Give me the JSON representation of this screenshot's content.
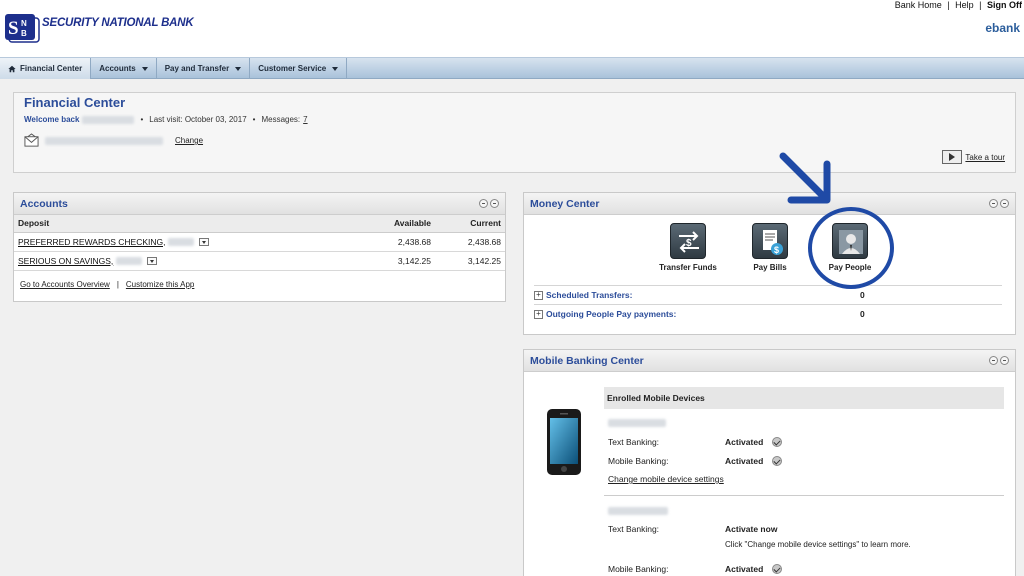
{
  "header": {
    "bank_name": "SECURITY NATIONAL BANK",
    "logo_letters": "SNB",
    "brand_right": "ebank",
    "links": {
      "home": "Bank Home",
      "sep": "|",
      "help": "Help",
      "sign_off": "Sign Off"
    }
  },
  "nav": {
    "items": [
      {
        "label": "Financial Center"
      },
      {
        "label": "Accounts"
      },
      {
        "label": "Pay and Transfer"
      },
      {
        "label": "Customer Service"
      }
    ]
  },
  "financial_center": {
    "title": "Financial Center",
    "welcome": "Welcome back",
    "bullet": "•",
    "last_visit": "Last visit: October 03, 2017",
    "messages_label": "Messages:",
    "messages_count": "7",
    "change": "Change",
    "take_tour": "Take a tour"
  },
  "accounts": {
    "title": "Accounts",
    "columns": {
      "name": "Deposit",
      "available": "Available",
      "current": "Current"
    },
    "rows": [
      {
        "name": "PREFERRED REWARDS CHECKING,",
        "available": "2,438.68",
        "current": "2,438.68"
      },
      {
        "name": "SERIOUS ON SAVINGS,",
        "available": "3,142.25",
        "current": "3,142.25"
      }
    ],
    "footer": {
      "overview": "Go to Accounts Overview",
      "pipe": "|",
      "customize": "Customize this App"
    }
  },
  "money_center": {
    "title": "Money Center",
    "actions": [
      {
        "label": "Transfer Funds",
        "icon": "transfer-icon"
      },
      {
        "label": "Pay Bills",
        "icon": "bill-icon"
      },
      {
        "label": "Pay People",
        "icon": "person-icon"
      }
    ],
    "rows": [
      {
        "label": "Scheduled Transfers:",
        "count": "0"
      },
      {
        "label": "Outgoing People Pay payments:",
        "count": "0"
      }
    ],
    "highlight_color": "#1f4aa6"
  },
  "mobile": {
    "title": "Mobile Banking Center",
    "enrolled_heading": "Enrolled Mobile Devices",
    "device1": {
      "text_banking_label": "Text Banking:",
      "text_banking_status": "Activated",
      "mobile_banking_label": "Mobile Banking:",
      "mobile_banking_status": "Activated",
      "change_link": "Change mobile device settings"
    },
    "device2": {
      "text_banking_label": "Text Banking:",
      "text_banking_status": "Activate now",
      "note": "Click \"Change mobile device settings\" to learn more.",
      "mobile_banking_label": "Mobile Banking:",
      "mobile_banking_status": "Activated"
    }
  }
}
